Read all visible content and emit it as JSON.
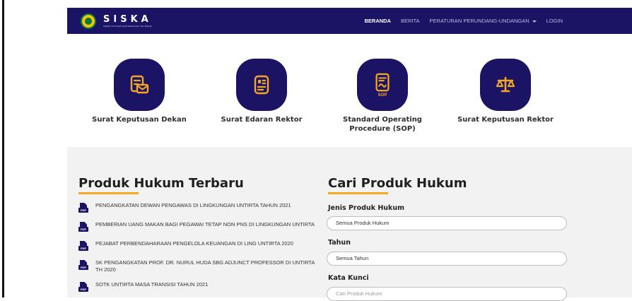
{
  "brand": {
    "name": "SISKA",
    "subtitle": "Sistem Informasi Surat Keputusan dan Edaran"
  },
  "nav": {
    "items": [
      {
        "label": "BERANDA",
        "active": true
      },
      {
        "label": "BERITA",
        "active": false
      },
      {
        "label": "PERATURAN PERUNDANG-UNDANGAN",
        "active": false,
        "dropdown": true
      },
      {
        "label": "LOGIN",
        "active": false
      }
    ]
  },
  "categories": [
    {
      "label": "Surat Keputusan Dekan",
      "icon": "document-envelope-icon"
    },
    {
      "label": "Surat Edaran Rektor",
      "icon": "id-card-document-icon"
    },
    {
      "label": "Standard Operating Procedure (SOP)",
      "icon": "sop-document-icon",
      "tag": "SOP"
    },
    {
      "label": "Surat Keputusan Rektor",
      "icon": "scales-icon"
    }
  ],
  "latest": {
    "title": "Produk Hukum Terbaru",
    "pdf_label": "PDF",
    "items": [
      "PENGANGKATAN DEWAN PENGAWAS DI LINGKUNGAN UNTIRTA TAHUN 2021",
      "PEMBERIAN UANG MAKAN BAGI PEGAWAI TETAP NON PNS DI LINGKUNGAN UNTIRTA",
      "PEJABAT PERBENDAHARAAN PENGELOLA KEUANGAN DI LING UNTIRTA 2020",
      "SK PENGANGKATAN PROF. DR. NURUL HUDA SBG ADJUNCT PROFESSOR DI UNTIRTA TH 2020",
      "SOTK UNTIRTA MASA TRANSISI TAHUN 2021"
    ]
  },
  "search": {
    "title": "Cari Produk Hukum",
    "jenis_label": "Jenis Produk Hukum",
    "jenis_value": "Semua Produk Hukum",
    "tahun_label": "Tahun",
    "tahun_value": "Semua Tahun",
    "kata_label": "Kata Kunci",
    "kata_placeholder": "Cari Produk Hukum"
  },
  "colors": {
    "navy": "#1b1464",
    "accent": "#f5a623",
    "background_lower": "#f2f2f2"
  }
}
